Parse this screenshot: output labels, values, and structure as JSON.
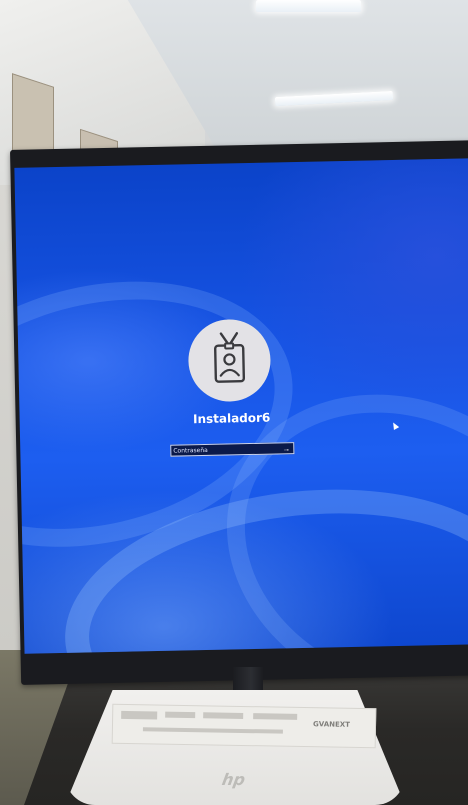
{
  "login": {
    "username": "Instalador6",
    "password_placeholder": "Contraseña",
    "submit_label": "→"
  },
  "stand": {
    "sticker_brand": "GVANEXT",
    "logo_text": "hp"
  },
  "colors": {
    "screen_blue": "#1653e3",
    "avatar_bg": "#e3e2e6"
  },
  "icons": {
    "avatar": "id-badge-user-icon",
    "submit": "arrow-right-icon",
    "pointer": "mouse-pointer-icon"
  }
}
